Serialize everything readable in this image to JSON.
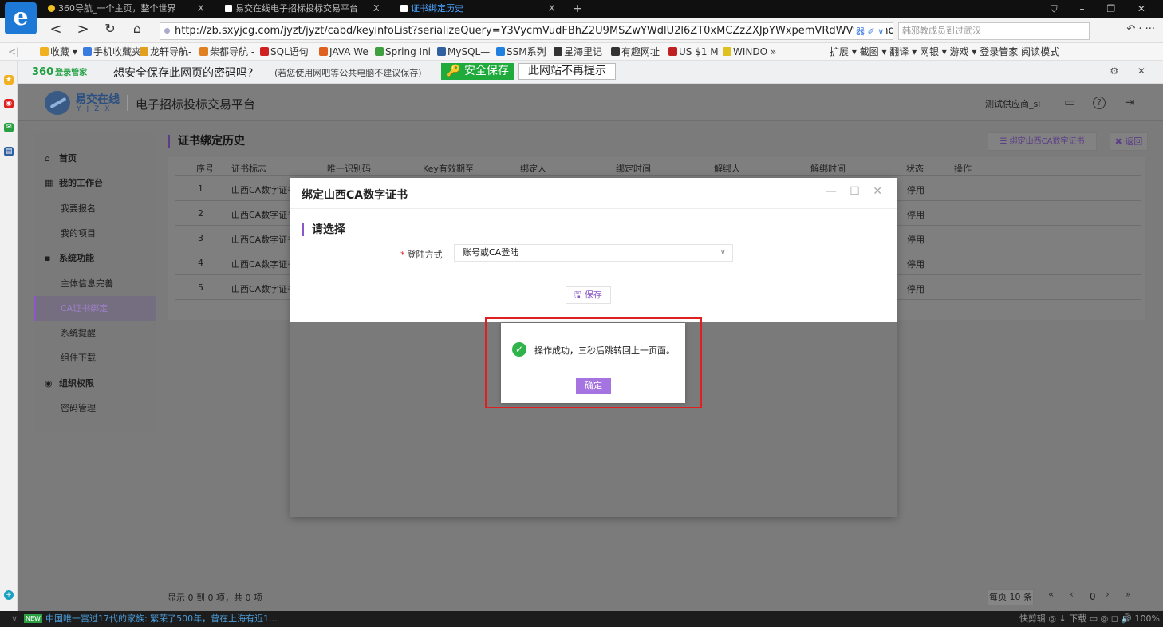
{
  "browser": {
    "tabs": [
      {
        "label": "360导航_一个主页，整个世界",
        "close": "X",
        "dot": "#f0c020"
      },
      {
        "label": "易交在线电子招标投标交易平台",
        "close": "X",
        "dot": "#ffffff"
      },
      {
        "label": "证书绑定历史",
        "close": "X",
        "dot": "#ffffff"
      }
    ],
    "new_tab": "+",
    "logo_glyph": "e",
    "window_controls": "⛉ – ❐ ✕",
    "nav": {
      "back": "<",
      "forward": ">",
      "refresh": "↻",
      "home": "⌂"
    },
    "url": "http://zb.sxyjcg.com/jyzt/jyzt/cabd/keyinfoList?serializeQuery=Y3VycmVudFBhZ2U9MSZwYWdlU2l6ZT0xMCZzZXJpYWxpemVRdWVyeT0mdXJsPSUyRmp",
    "url_suffix": "器 ✐ ∨",
    "search_placeholder": "韩邪教成员到过武汉",
    "addr_right": "↶ · ···"
  },
  "favorites": [
    {
      "label": "收藏 ▾",
      "color": "#f0b020"
    },
    {
      "label": "手机收藏夹",
      "color": "#3a7be0"
    },
    {
      "label": "龙轩导航-",
      "color": "#e0a020"
    },
    {
      "label": "柴都导航 -",
      "color": "#e08020"
    },
    {
      "label": "SQL语句",
      "color": "#d02020"
    },
    {
      "label": "JAVA We",
      "color": "#e06020"
    },
    {
      "label": "Spring Ini",
      "color": "#40a040"
    },
    {
      "label": "MySQL—",
      "color": "#3060a0"
    },
    {
      "label": "SSM系列",
      "color": "#2080e0"
    },
    {
      "label": "星海里记",
      "color": "#333333"
    },
    {
      "label": "有趣网址",
      "color": "#333333"
    },
    {
      "label": "US $1 M",
      "color": "#c02020"
    },
    {
      "label": "WINDO »",
      "color": "#e0c020"
    }
  ],
  "favorites_right": "扩展 ▾  截图 ▾  翻译 ▾  网银 ▾  游戏 ▾  登录管家  阅读模式",
  "password_bar": {
    "logo": "360",
    "logo_sub": "登录管家",
    "question": "想安全保存此网页的密码吗?",
    "hint": "(若您使用网吧等公共电脑不建议保存)",
    "save": "安全保存",
    "never": "此网站不再提示",
    "right": "⚙ ✕"
  },
  "app": {
    "brand": "易交在线",
    "brand_sub": "YJZX",
    "title": "电子招标投标交易平台",
    "user": "测试供应商_sl",
    "icons": {
      "message": "▭",
      "help": "?",
      "logout": "⇥"
    }
  },
  "sidebar": [
    {
      "label": "首页",
      "icon": "⌂",
      "group": true
    },
    {
      "label": "我的工作台",
      "icon": "▦",
      "group": true
    },
    {
      "label": "我要报名",
      "group": false
    },
    {
      "label": "我的项目",
      "group": false
    },
    {
      "label": "系统功能",
      "icon": "▪",
      "group": true
    },
    {
      "label": "主体信息完善",
      "group": false
    },
    {
      "label": "CA证书绑定",
      "group": false,
      "active": true
    },
    {
      "label": "系统提醒",
      "group": false
    },
    {
      "label": "组件下载",
      "group": false
    },
    {
      "label": "组织权限",
      "icon": "◉",
      "group": true
    },
    {
      "label": "密码管理",
      "group": false
    }
  ],
  "content": {
    "title": "证书绑定历史",
    "bind_button": "☰ 绑定山西CA数字证书",
    "back_button": "✖ 返回"
  },
  "table": {
    "headers": [
      "序号",
      "证书标志",
      "唯一识别码",
      "Key有效期至",
      "绑定人",
      "绑定时间",
      "解绑人",
      "解绑时间",
      "状态",
      "操作"
    ],
    "rows": [
      {
        "no": "1",
        "cert": "山西CA数字证书",
        "status": "停用"
      },
      {
        "no": "2",
        "cert": "山西CA数字证书",
        "status": "停用"
      },
      {
        "no": "3",
        "cert": "山西CA数字证书",
        "status": "停用"
      },
      {
        "no": "4",
        "cert": "山西CA数字证书",
        "status": "停用"
      },
      {
        "no": "5",
        "cert": "山西CA数字证书",
        "status": "停用"
      }
    ]
  },
  "pager": {
    "info": "显示 0 到 0 项，共 0 项",
    "page_size": "每页 10 条",
    "nav": "« ‹",
    "current": "0",
    "nav_next": "› »"
  },
  "modal": {
    "title": "绑定山西CA数字证书",
    "controls": "— ☐ ✕",
    "section": "请选择",
    "field_label": "登陆方式",
    "required": "*",
    "field_value": "账号或CA登陆",
    "save_button": "🖫 保存"
  },
  "toast": {
    "icon": "✓",
    "message": "操作成功，三秒后跳转回上一页面。",
    "ok": "确定"
  },
  "status_bar": {
    "tag": "NEW",
    "news": "中国唯一富过17代的家族: 繁荣了500年，曾在上海有近1...",
    "right": "快剪辑  ◎  ↓ 下载  ▭  ◎  ◻  🔊  100%"
  }
}
